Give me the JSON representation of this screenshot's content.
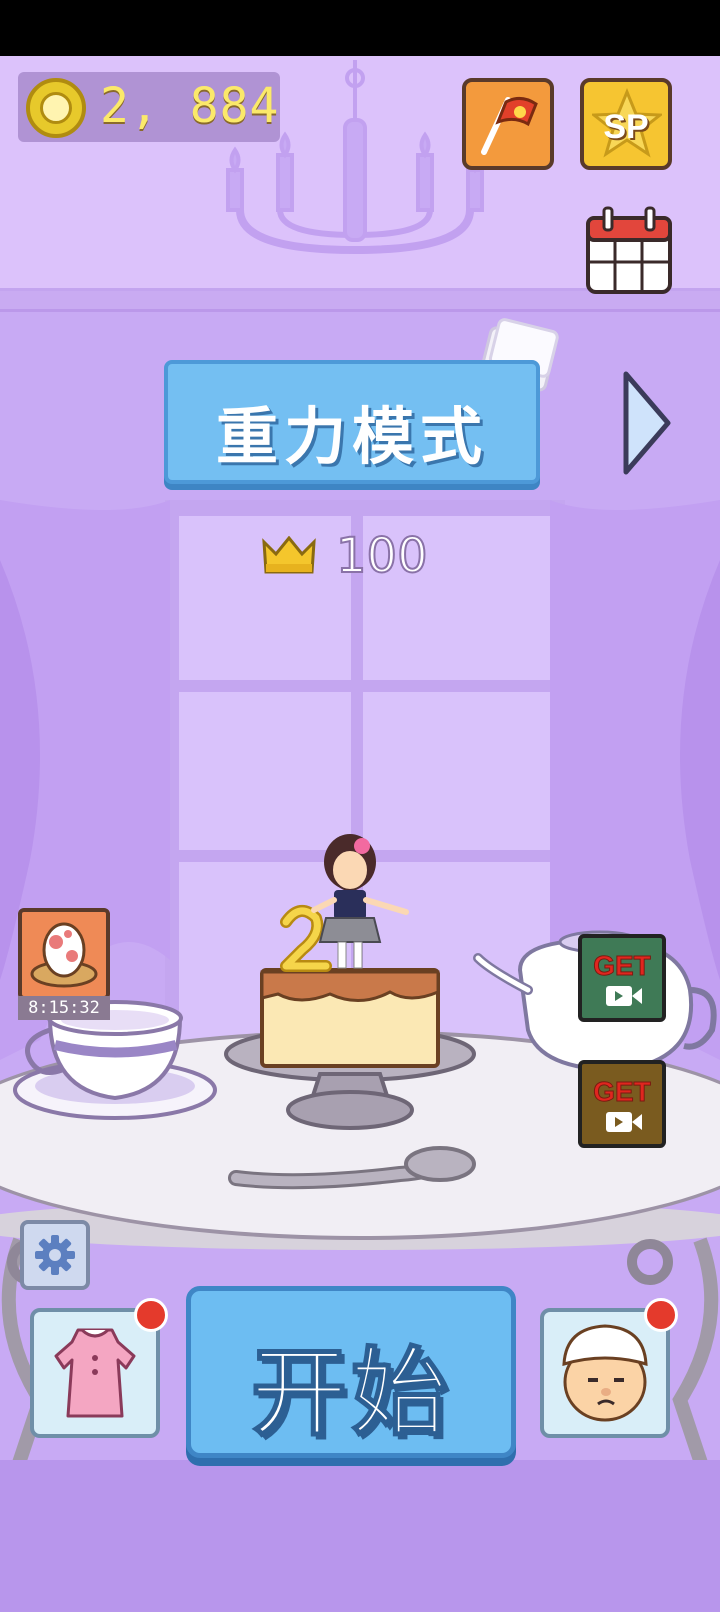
{
  "hud": {
    "coins": "2, 884",
    "coin_icon": "coin-icon",
    "flag_icon": "flag-icon",
    "sp_label": "SP",
    "calendar_icon": "calendar-icon"
  },
  "mode": {
    "title": "重力模式",
    "next_icon": "chevron-right-icon",
    "best_icon": "crown-icon",
    "best_score": "100"
  },
  "side": {
    "egg_timer": "8:15:32",
    "get_label_1": "GET",
    "get_label_2": "GET",
    "video_icon": "video-camera-icon"
  },
  "bottom": {
    "start_label": "开始",
    "settings_icon": "gear-icon",
    "dress_icon": "dress-icon",
    "chef_icon": "chef-face-icon"
  },
  "colors": {
    "wall": "#c8aaf4",
    "banner_blue": "#74bff2",
    "coin_text": "#fbe96a",
    "notify_red": "#e43a2c"
  }
}
